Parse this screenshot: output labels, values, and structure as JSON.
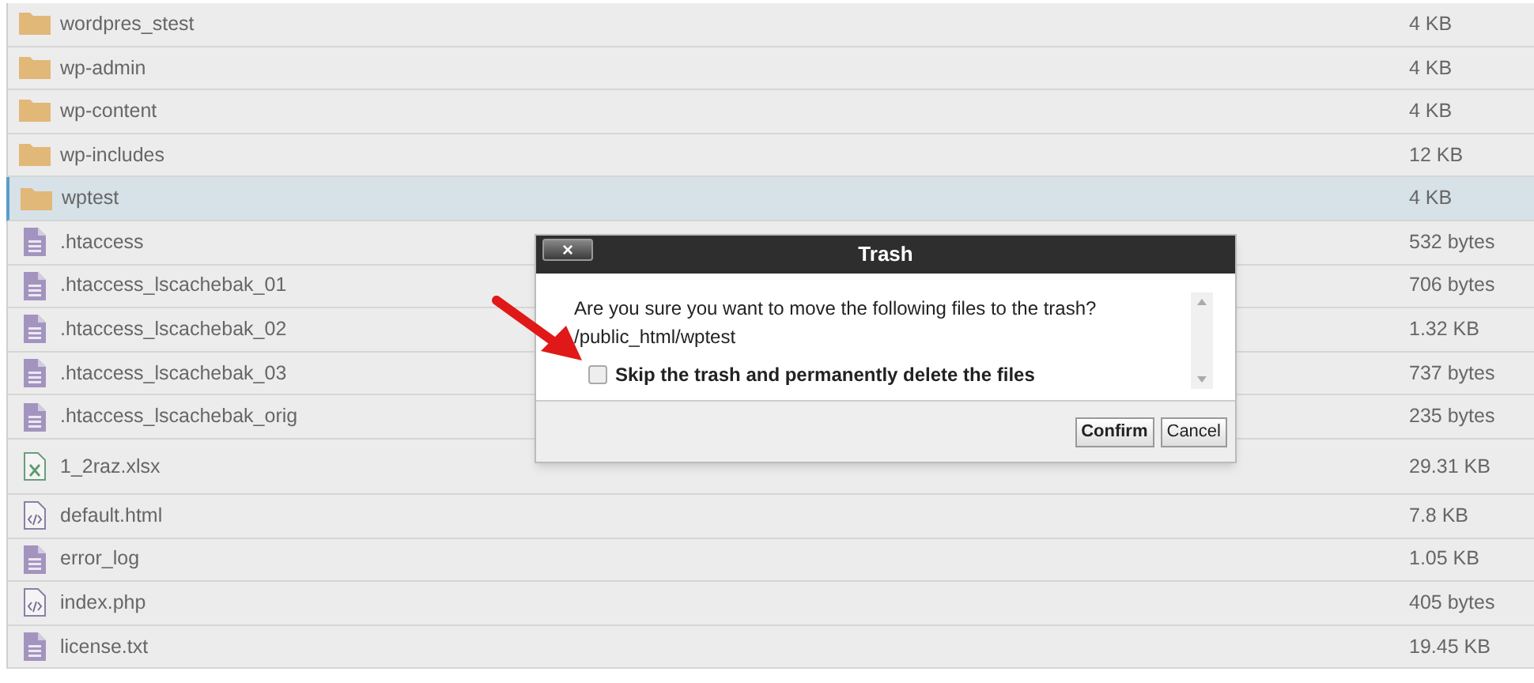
{
  "files": [
    {
      "kind": "folder",
      "name": "wordpres_stest",
      "size": "4 KB",
      "selected": false
    },
    {
      "kind": "folder",
      "name": "wp-admin",
      "size": "4 KB",
      "selected": false
    },
    {
      "kind": "folder",
      "name": "wp-content",
      "size": "4 KB",
      "selected": false
    },
    {
      "kind": "folder",
      "name": "wp-includes",
      "size": "12 KB",
      "selected": false
    },
    {
      "kind": "folder",
      "name": "wptest",
      "size": "4 KB",
      "selected": true
    },
    {
      "kind": "text",
      "name": ".htaccess",
      "size": "532 bytes",
      "selected": false
    },
    {
      "kind": "text",
      "name": ".htaccess_lscachebak_01",
      "size": "706 bytes",
      "selected": false
    },
    {
      "kind": "text",
      "name": ".htaccess_lscachebak_02",
      "size": "1.32 KB",
      "selected": false
    },
    {
      "kind": "text",
      "name": ".htaccess_lscachebak_03",
      "size": "737 bytes",
      "selected": false
    },
    {
      "kind": "text",
      "name": ".htaccess_lscachebak_orig",
      "size": "235 bytes",
      "selected": false
    },
    {
      "kind": "sheet",
      "name": "1_2raz.xlsx",
      "size": "29.31 KB",
      "selected": false
    },
    {
      "kind": "code",
      "name": "default.html",
      "size": "7.8 KB",
      "selected": false
    },
    {
      "kind": "text",
      "name": "error_log",
      "size": "1.05 KB",
      "selected": false
    },
    {
      "kind": "code",
      "name": "index.php",
      "size": "405 bytes",
      "selected": false
    },
    {
      "kind": "text",
      "name": "license.txt",
      "size": "19.45 KB",
      "selected": false
    }
  ],
  "dialog": {
    "close": "×",
    "title": "Trash",
    "message": "Are you sure you want to move the following files to the trash?",
    "path": "/public_html/wptest",
    "option": {
      "label": "Skip the trash and permanently delete the files",
      "checked": false
    },
    "buttons": [
      "Confirm",
      "Cancel"
    ]
  }
}
